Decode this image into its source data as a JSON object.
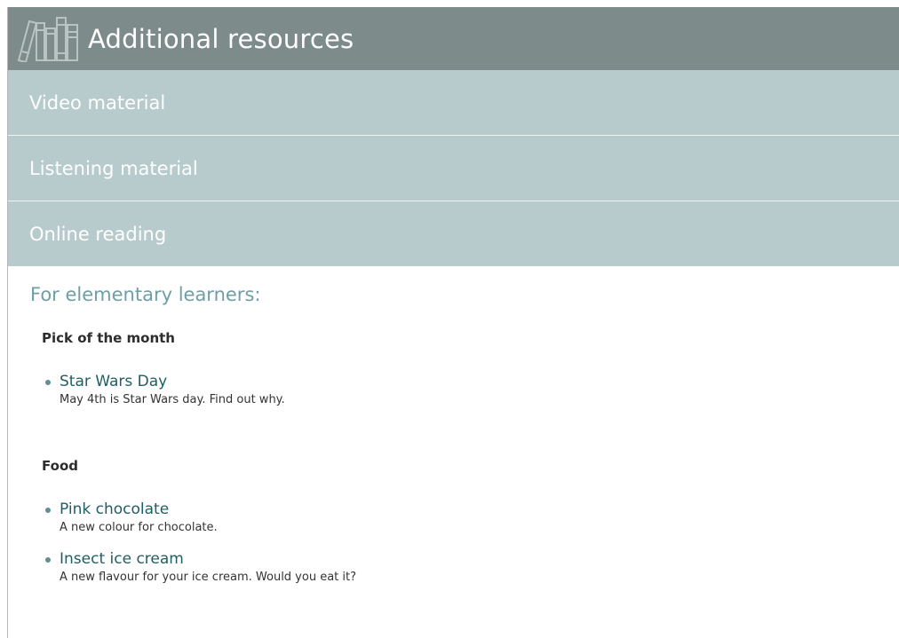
{
  "header": {
    "title": "Additional resources",
    "icon": "books-icon",
    "background": "#7d8b8a"
  },
  "accordion": {
    "items": [
      {
        "label": "Video material"
      },
      {
        "label": "Listening material"
      },
      {
        "label": "Online reading"
      }
    ],
    "background": "#b7cbcd"
  },
  "content": {
    "level_heading": "For elementary learners:",
    "sections": [
      {
        "heading": "Pick of the month",
        "items": [
          {
            "title": "Star Wars Day",
            "description": "May 4th is Star Wars day. Find out why."
          }
        ]
      },
      {
        "heading": "Food",
        "items": [
          {
            "title": "Pink chocolate",
            "description": "A new colour for chocolate."
          },
          {
            "title": "Insect ice cream",
            "description": "A new flavour for your ice cream. Would you eat it?"
          }
        ]
      }
    ]
  }
}
